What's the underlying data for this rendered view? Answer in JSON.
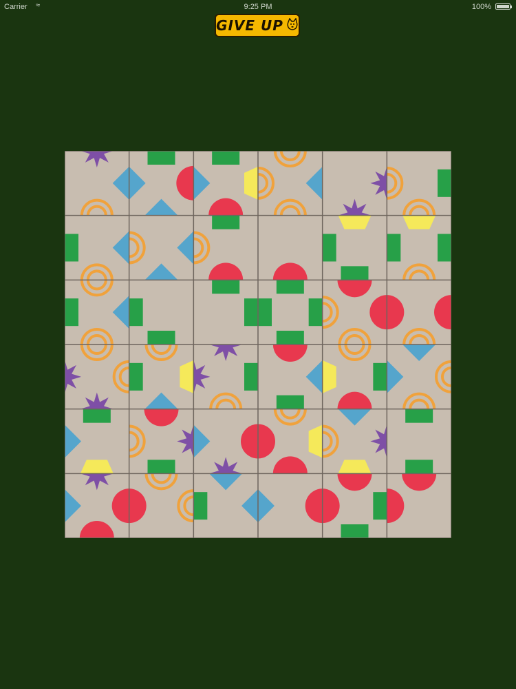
{
  "status_bar": {
    "carrier": "Carrier",
    "time": "9:25 PM",
    "battery": "100%"
  },
  "give_up_button": {
    "label": "GIVE UP",
    "icon": "cat-icon"
  },
  "board": {
    "rows": 6,
    "cols": 6,
    "tile_color": "#c8bdb0",
    "grid_color": "#6e655d",
    "colors": {
      "green": "#27a048",
      "blue": "#55a5cc",
      "red": "#e8384e",
      "yellow": "#f5e95a",
      "purple": "#7e4fa6",
      "orange": "#f0a23c"
    },
    "tiles": [
      [
        {
          "top": "purple-star",
          "right": "blue-diamond",
          "bottom": "orange-rings",
          "left": "none"
        },
        {
          "top": "green-rect",
          "right": "red-circle",
          "bottom": "blue-diamond",
          "left": "blue-diamond"
        },
        {
          "top": "green-rect",
          "right": "yellow-hexagon",
          "bottom": "red-circle",
          "left": "blue-diamond"
        },
        {
          "top": "orange-rings",
          "right": "blue-diamond",
          "bottom": "orange-rings",
          "left": "orange-rings"
        },
        {
          "top": "none",
          "right": "purple-star",
          "bottom": "purple-star",
          "left": "none"
        },
        {
          "top": "none",
          "right": "green-rect",
          "bottom": "orange-rings",
          "left": "orange-rings"
        }
      ],
      [
        {
          "top": "none",
          "right": "blue-diamond",
          "bottom": "orange-rings",
          "left": "green-rect"
        },
        {
          "top": "none",
          "right": "blue-diamond",
          "bottom": "blue-diamond",
          "left": "orange-rings"
        },
        {
          "top": "green-rect",
          "right": "none",
          "bottom": "red-circle",
          "left": "orange-rings"
        },
        {
          "top": "none",
          "right": "none",
          "bottom": "red-circle",
          "left": "none"
        },
        {
          "top": "yellow-hexagon",
          "right": "none",
          "bottom": "green-rect",
          "left": "green-rect"
        },
        {
          "top": "yellow-hexagon",
          "right": "green-rect",
          "bottom": "orange-rings",
          "left": "green-rect"
        }
      ],
      [
        {
          "top": "orange-rings",
          "right": "blue-diamond",
          "bottom": "orange-rings",
          "left": "green-rect"
        },
        {
          "top": "none",
          "right": "none",
          "bottom": "green-rect",
          "left": "green-rect"
        },
        {
          "top": "green-rect",
          "right": "green-rect",
          "bottom": "none",
          "left": "none"
        },
        {
          "top": "green-rect",
          "right": "green-rect",
          "bottom": "green-rect",
          "left": "green-rect"
        },
        {
          "top": "red-circle",
          "right": "red-circle",
          "bottom": "orange-rings",
          "left": "orange-rings"
        },
        {
          "top": "none",
          "right": "red-circle",
          "bottom": "orange-rings",
          "left": "red-circle"
        }
      ],
      [
        {
          "top": "orange-rings",
          "right": "orange-rings",
          "bottom": "purple-star",
          "left": "purple-star"
        },
        {
          "top": "orange-rings",
          "right": "yellow-hexagon",
          "bottom": "blue-diamond",
          "left": "green-rect"
        },
        {
          "top": "purple-star",
          "right": "green-rect",
          "bottom": "orange-rings",
          "left": "purple-star"
        },
        {
          "top": "red-circle",
          "right": "blue-diamond",
          "bottom": "green-rect",
          "left": "none"
        },
        {
          "top": "orange-rings",
          "right": "green-rect",
          "bottom": "red-circle",
          "left": "yellow-hexagon"
        },
        {
          "top": "blue-diamond",
          "right": "orange-rings",
          "bottom": "orange-rings",
          "left": "blue-diamond"
        }
      ],
      [
        {
          "top": "green-rect",
          "right": "none",
          "bottom": "yellow-hexagon",
          "left": "blue-diamond"
        },
        {
          "top": "red-circle",
          "right": "purple-star",
          "bottom": "green-rect",
          "left": "orange-rings"
        },
        {
          "top": "none",
          "right": "red-circle",
          "bottom": "purple-star",
          "left": "blue-diamond"
        },
        {
          "top": "orange-rings",
          "right": "yellow-hexagon",
          "bottom": "red-circle",
          "left": "red-circle"
        },
        {
          "top": "blue-diamond",
          "right": "purple-star",
          "bottom": "yellow-hexagon",
          "left": "orange-rings"
        },
        {
          "top": "green-rect",
          "right": "none",
          "bottom": "green-rect",
          "left": "none"
        }
      ],
      [
        {
          "top": "purple-star",
          "right": "red-circle",
          "bottom": "red-circle",
          "left": "blue-diamond"
        },
        {
          "top": "orange-rings",
          "right": "orange-rings",
          "bottom": "none",
          "left": "red-circle"
        },
        {
          "top": "blue-diamond",
          "right": "blue-diamond",
          "bottom": "none",
          "left": "green-rect"
        },
        {
          "top": "none",
          "right": "red-circle",
          "bottom": "none",
          "left": "blue-diamond"
        },
        {
          "top": "red-circle",
          "right": "green-rect",
          "bottom": "green-rect",
          "left": "red-circle"
        },
        {
          "top": "red-circle",
          "right": "none",
          "bottom": "none",
          "left": "red-circle"
        }
      ]
    ]
  }
}
